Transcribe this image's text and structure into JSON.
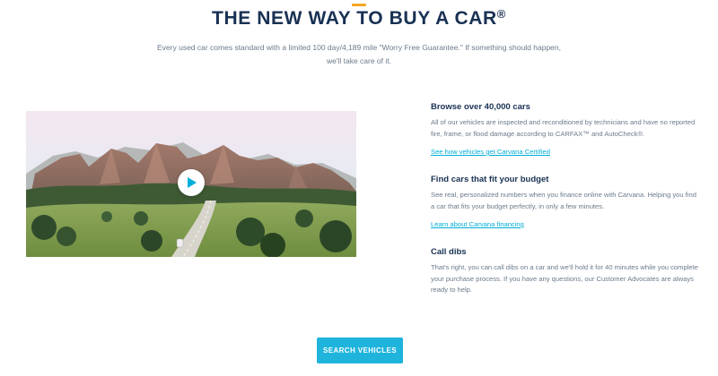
{
  "headline": {
    "text": "THE NEW WAY TO BUY A CAR",
    "mark": "®"
  },
  "subline": "Every used car comes standard with a limited 100 day/4,189 mile \"Worry Free Guarantee.\" If something should happen, we'll take care of it.",
  "features": [
    {
      "title": "Browse over 40,000 cars",
      "body": "All of our vehicles are inspected and reconditioned by technicians and have no reported fire, frame, or flood damage according to CARFAX™ and AutoCheck®.",
      "link": "See how vehicles get Carvana Certified"
    },
    {
      "title": "Find cars that fit your budget",
      "body": "See real, personalized numbers when you finance online with Carvana. Helping you find a car that fits your budget perfectly, in only a few minutes.",
      "link": "Learn about Carvana financing"
    },
    {
      "title": "Call dibs",
      "body": "That's right, you can call dibs on a car and we'll hold it for 40 minutes while you complete your purchase process. If you have any questions, our Customer Advocates are always ready to help."
    }
  ],
  "cta": {
    "label": "SEARCH VEHICLES"
  },
  "icons": {
    "play": "play-icon"
  },
  "colors": {
    "navy": "#183153",
    "accent": "#00aed9",
    "button": "#1fb4dc",
    "orange": "#f5a623",
    "muted": "#6b7b8c"
  }
}
